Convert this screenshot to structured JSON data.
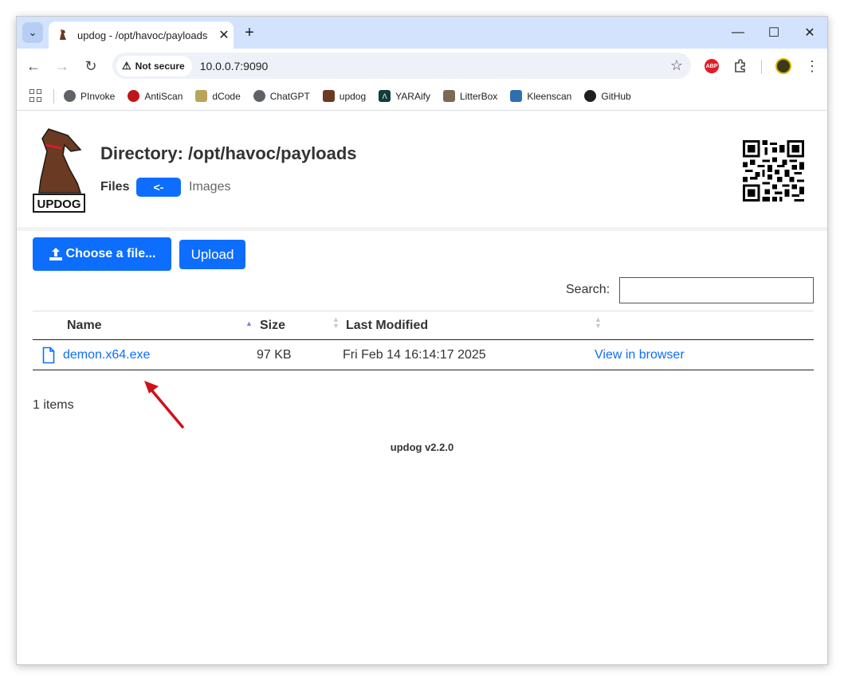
{
  "browser": {
    "tab_title": "updog - /opt/havoc/payloads",
    "security_label": "Not secure",
    "url": "10.0.0.7:9090",
    "bookmarks": [
      {
        "label": "PInvoke"
      },
      {
        "label": "AntiScan"
      },
      {
        "label": "dCode"
      },
      {
        "label": "ChatGPT"
      },
      {
        "label": "updog"
      },
      {
        "label": "YARAify"
      },
      {
        "label": "LitterBox"
      },
      {
        "label": "Kleenscan"
      },
      {
        "label": "GitHub"
      }
    ],
    "extensions": {
      "abp_label": "ABP"
    }
  },
  "page": {
    "title": "Directory: /opt/havoc/payloads",
    "logo_text": "UPDOG",
    "files_label": "Files",
    "back_label": "<-",
    "images_label": "Images",
    "choose_label": "Choose a file...",
    "upload_label": "Upload",
    "search_label": "Search:",
    "search_value": "",
    "table": {
      "columns": [
        "Name",
        "Size",
        "Last Modified"
      ],
      "rows": [
        {
          "name": "demon.x64.exe",
          "size": "97 KB",
          "modified": "Fri Feb 14 16:14:17 2025",
          "action": "View in browser"
        }
      ]
    },
    "items_count": "1 items",
    "footer": "updog v2.2.0"
  },
  "colors": {
    "primary": "#0d6efd",
    "annotation_arrow": "#d0101a",
    "tab_strip": "#d3e3fd"
  }
}
